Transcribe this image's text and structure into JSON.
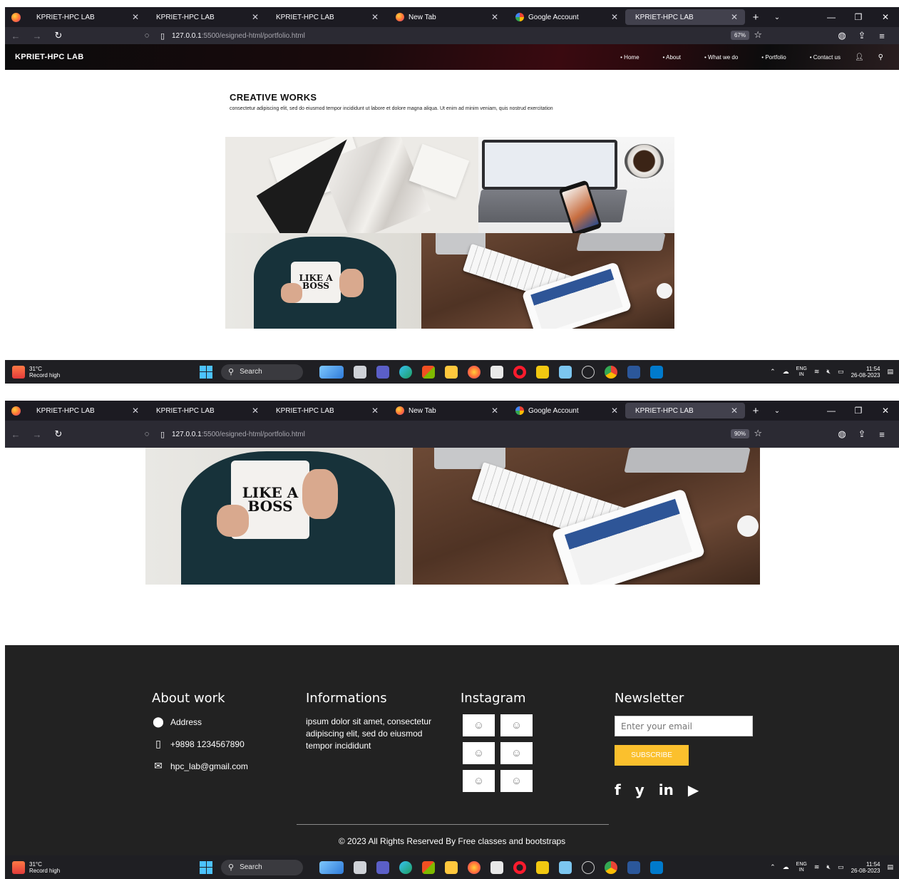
{
  "browser": {
    "tabs": [
      {
        "label": "KPRIET-HPC LAB",
        "icon": "none"
      },
      {
        "label": "KPRIET-HPC LAB",
        "icon": "none"
      },
      {
        "label": "KPRIET-HPC LAB",
        "icon": "none"
      },
      {
        "label": "New Tab",
        "icon": "firefox-icon"
      },
      {
        "label": "Google Account",
        "icon": "google-icon"
      },
      {
        "label": "KPRIET-HPC LAB",
        "icon": "none",
        "active": true
      }
    ],
    "url_host": "127.0.0.1",
    "url_path": ":5500/esigned-html/portfolio.html",
    "zoom_top": "67%",
    "zoom_bottom": "90%"
  },
  "site": {
    "brand": "KPRIET-HPC LAB",
    "menu": [
      "Home",
      "About",
      "What we do",
      "Portfolio",
      "Contact us"
    ],
    "section_title": "CREATIVE WORKS",
    "section_desc": "consectetur adipiscing elit, sed do eiusmod tempor incididunt ut labore et dolore magna aliqua. Ut enim ad minim veniam, quis nostrud exercitation",
    "mug_text": "LIKE A BOSS"
  },
  "footer": {
    "about_title": "About work",
    "address": "Address",
    "phone": "+9898 1234567890",
    "email": "hpc_lab@gmail.com",
    "info_title": "Informations",
    "info_text": "ipsum dolor sit amet, consectetur adipiscing elit, sed do eiusmod tempor incididunt",
    "insta_title": "Instagram",
    "newsletter_title": "Newsletter",
    "email_placeholder": "Enter your email",
    "subscribe_label": "SUBSCRIBE",
    "social": [
      "f",
      "y",
      "in",
      "▶"
    ],
    "copyright": "© 2023 All Rights Reserved By Free classes and bootstraps"
  },
  "taskbar": {
    "temp": "31°C",
    "weather_note": "Record high",
    "search": "Search",
    "lang_top": "ENG",
    "lang_bottom": "IN",
    "time": "11:54",
    "date": "26-08-2023"
  },
  "colors": {
    "tabbar": "#1c1b22",
    "navbar": "#2b2a33",
    "footer_bg": "#222222",
    "subscribe": "#fbc02d",
    "taskbar": "#1f1f23"
  }
}
